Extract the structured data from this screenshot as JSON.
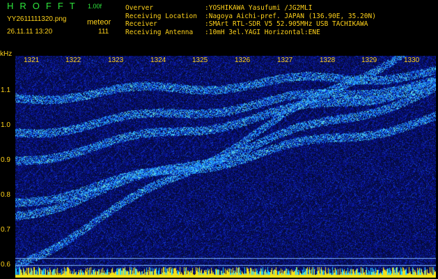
{
  "header": {
    "app_title": "HROFFT",
    "app_version": "1.00f",
    "file_name": "YY2611111320.png",
    "mode": "meteor",
    "timestamp": "26.11.11 13:20",
    "count": "111"
  },
  "meta": [
    {
      "key": "Overver",
      "value": ":YOSHIKAWA Yasufumi /JG2MLI"
    },
    {
      "key": "Receiving Location",
      "value": ":Nagoya Aichi-pref. JAPAN (136.90E, 35.20N)"
    },
    {
      "key": "Receiver",
      "value": ":SMArt RTL-SDR V5 52.905MHz USB TACHIKAWA"
    },
    {
      "key": "Receiving Antenna",
      "value": ":10mH 3el.YAGI Horizontal:ENE"
    }
  ],
  "axes": {
    "y_unit": "kHz",
    "y_ticks": [
      "1.1",
      "1.0",
      "0.9",
      "0.8",
      "0.7",
      "0.6"
    ],
    "x_ticks": [
      "1321",
      "1322",
      "1323",
      "1324",
      "1325",
      "1326",
      "1327",
      "1328",
      "1329",
      "1330"
    ]
  },
  "colors": {
    "background": "#000000",
    "label_yellow": "#ffd21a",
    "title_green": "#2ee63c",
    "spectrogram_base": "#050a3a"
  }
}
